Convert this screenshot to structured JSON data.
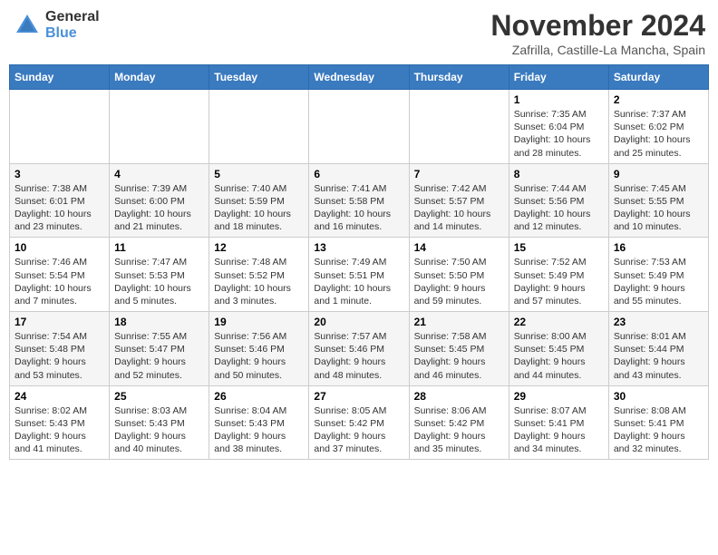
{
  "header": {
    "logo_general": "General",
    "logo_blue": "Blue",
    "title": "November 2024",
    "location": "Zafrilla, Castille-La Mancha, Spain"
  },
  "calendar": {
    "weekdays": [
      "Sunday",
      "Monday",
      "Tuesday",
      "Wednesday",
      "Thursday",
      "Friday",
      "Saturday"
    ],
    "weeks": [
      [
        {
          "day": "",
          "info": ""
        },
        {
          "day": "",
          "info": ""
        },
        {
          "day": "",
          "info": ""
        },
        {
          "day": "",
          "info": ""
        },
        {
          "day": "",
          "info": ""
        },
        {
          "day": "1",
          "info": "Sunrise: 7:35 AM\nSunset: 6:04 PM\nDaylight: 10 hours and 28 minutes."
        },
        {
          "day": "2",
          "info": "Sunrise: 7:37 AM\nSunset: 6:02 PM\nDaylight: 10 hours and 25 minutes."
        }
      ],
      [
        {
          "day": "3",
          "info": "Sunrise: 7:38 AM\nSunset: 6:01 PM\nDaylight: 10 hours and 23 minutes."
        },
        {
          "day": "4",
          "info": "Sunrise: 7:39 AM\nSunset: 6:00 PM\nDaylight: 10 hours and 21 minutes."
        },
        {
          "day": "5",
          "info": "Sunrise: 7:40 AM\nSunset: 5:59 PM\nDaylight: 10 hours and 18 minutes."
        },
        {
          "day": "6",
          "info": "Sunrise: 7:41 AM\nSunset: 5:58 PM\nDaylight: 10 hours and 16 minutes."
        },
        {
          "day": "7",
          "info": "Sunrise: 7:42 AM\nSunset: 5:57 PM\nDaylight: 10 hours and 14 minutes."
        },
        {
          "day": "8",
          "info": "Sunrise: 7:44 AM\nSunset: 5:56 PM\nDaylight: 10 hours and 12 minutes."
        },
        {
          "day": "9",
          "info": "Sunrise: 7:45 AM\nSunset: 5:55 PM\nDaylight: 10 hours and 10 minutes."
        }
      ],
      [
        {
          "day": "10",
          "info": "Sunrise: 7:46 AM\nSunset: 5:54 PM\nDaylight: 10 hours and 7 minutes."
        },
        {
          "day": "11",
          "info": "Sunrise: 7:47 AM\nSunset: 5:53 PM\nDaylight: 10 hours and 5 minutes."
        },
        {
          "day": "12",
          "info": "Sunrise: 7:48 AM\nSunset: 5:52 PM\nDaylight: 10 hours and 3 minutes."
        },
        {
          "day": "13",
          "info": "Sunrise: 7:49 AM\nSunset: 5:51 PM\nDaylight: 10 hours and 1 minute."
        },
        {
          "day": "14",
          "info": "Sunrise: 7:50 AM\nSunset: 5:50 PM\nDaylight: 9 hours and 59 minutes."
        },
        {
          "day": "15",
          "info": "Sunrise: 7:52 AM\nSunset: 5:49 PM\nDaylight: 9 hours and 57 minutes."
        },
        {
          "day": "16",
          "info": "Sunrise: 7:53 AM\nSunset: 5:49 PM\nDaylight: 9 hours and 55 minutes."
        }
      ],
      [
        {
          "day": "17",
          "info": "Sunrise: 7:54 AM\nSunset: 5:48 PM\nDaylight: 9 hours and 53 minutes."
        },
        {
          "day": "18",
          "info": "Sunrise: 7:55 AM\nSunset: 5:47 PM\nDaylight: 9 hours and 52 minutes."
        },
        {
          "day": "19",
          "info": "Sunrise: 7:56 AM\nSunset: 5:46 PM\nDaylight: 9 hours and 50 minutes."
        },
        {
          "day": "20",
          "info": "Sunrise: 7:57 AM\nSunset: 5:46 PM\nDaylight: 9 hours and 48 minutes."
        },
        {
          "day": "21",
          "info": "Sunrise: 7:58 AM\nSunset: 5:45 PM\nDaylight: 9 hours and 46 minutes."
        },
        {
          "day": "22",
          "info": "Sunrise: 8:00 AM\nSunset: 5:45 PM\nDaylight: 9 hours and 44 minutes."
        },
        {
          "day": "23",
          "info": "Sunrise: 8:01 AM\nSunset: 5:44 PM\nDaylight: 9 hours and 43 minutes."
        }
      ],
      [
        {
          "day": "24",
          "info": "Sunrise: 8:02 AM\nSunset: 5:43 PM\nDaylight: 9 hours and 41 minutes."
        },
        {
          "day": "25",
          "info": "Sunrise: 8:03 AM\nSunset: 5:43 PM\nDaylight: 9 hours and 40 minutes."
        },
        {
          "day": "26",
          "info": "Sunrise: 8:04 AM\nSunset: 5:43 PM\nDaylight: 9 hours and 38 minutes."
        },
        {
          "day": "27",
          "info": "Sunrise: 8:05 AM\nSunset: 5:42 PM\nDaylight: 9 hours and 37 minutes."
        },
        {
          "day": "28",
          "info": "Sunrise: 8:06 AM\nSunset: 5:42 PM\nDaylight: 9 hours and 35 minutes."
        },
        {
          "day": "29",
          "info": "Sunrise: 8:07 AM\nSunset: 5:41 PM\nDaylight: 9 hours and 34 minutes."
        },
        {
          "day": "30",
          "info": "Sunrise: 8:08 AM\nSunset: 5:41 PM\nDaylight: 9 hours and 32 minutes."
        }
      ]
    ]
  }
}
